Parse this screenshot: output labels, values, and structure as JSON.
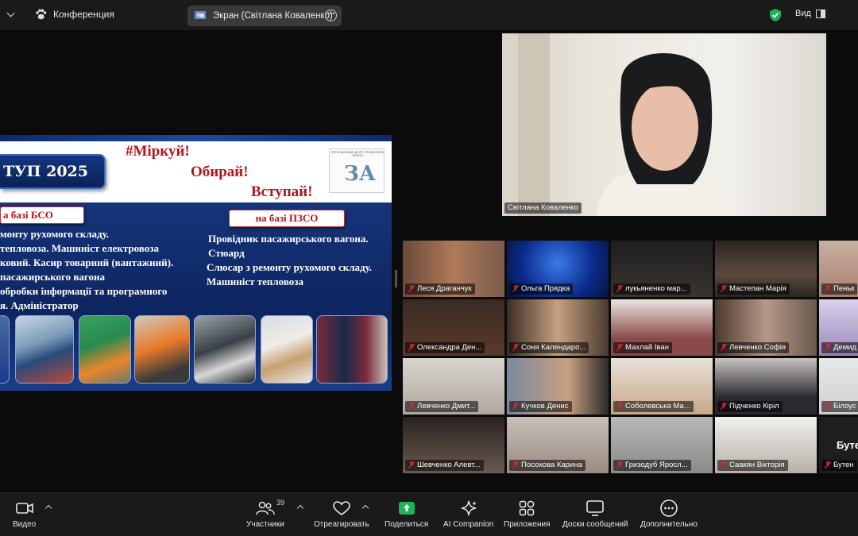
{
  "topbar": {
    "meeting_label": "Конференция",
    "share_label": "Экран (Світлана Коваленко)",
    "view_label": "Вид"
  },
  "slide": {
    "title": "ТУП 2025",
    "slogans": [
      "#Міркуй!",
      "Обирай!",
      "Вступай!"
    ],
    "logo_text": "РЕГІОНАЛЬНИЙ ЦЕНТР ПРОФЕСІЙНОЇ ОСВІТИ",
    "logo_letters": "ЗА",
    "left_chip": "а базі БСО",
    "left_lines": [
      "монту рухомого складу.",
      "тепловоза. Машиніст електровоза",
      "ковий. Касир товарний (вантажний).",
      "пасажирського вагона",
      "обробки інформації  та програмного",
      "я. Адміністратор"
    ],
    "right_chip": "на базі ПЗСО",
    "right_lines": [
      "Провідник пасажирського вагона.",
      "Стюард",
      "Слюсар з ремонту рухомого складу.",
      "Машиніст тепловоза"
    ]
  },
  "speaker": {
    "name": "Світлана Коваленко"
  },
  "gallery": {
    "participants": [
      {
        "name": "Леся Драганчук"
      },
      {
        "name": "Ольга Прядка"
      },
      {
        "name": "лукьяненко мар..."
      },
      {
        "name": "Мастепан Марія"
      },
      {
        "name": "Пеньк"
      },
      {
        "name": "Олександра Ден..."
      },
      {
        "name": "Соня Календаро..."
      },
      {
        "name": "Махлай Іван"
      },
      {
        "name": "Левченко Софія"
      },
      {
        "name": "Демид"
      },
      {
        "name": "Левченко Дмит..."
      },
      {
        "name": "Кучков Денис"
      },
      {
        "name": "Соболевська Ма..."
      },
      {
        "name": "Підченко Кіріл"
      },
      {
        "name": "Білоус"
      },
      {
        "name": "Шевченко Алевт..."
      },
      {
        "name": "Посохова Карина"
      },
      {
        "name": "Гризодуб Яросл..."
      },
      {
        "name": "Саакян Вікторія"
      },
      {
        "name": "Бутен"
      }
    ],
    "avatar_text": "Буте"
  },
  "toolbar": {
    "video": "Видео",
    "participants": "Участники",
    "participants_count": "39",
    "react": "Отреагировать",
    "share": "Поделиться",
    "ai": "AI Companion",
    "apps": "Приложения",
    "boards": "Доски сообщений",
    "more": "Дополнительно"
  },
  "colors": {
    "share_green": "#1fb35b",
    "muted_red": "#e0262e",
    "slide_navy": "#0e2a66",
    "slogan_red": "#b5141b"
  }
}
